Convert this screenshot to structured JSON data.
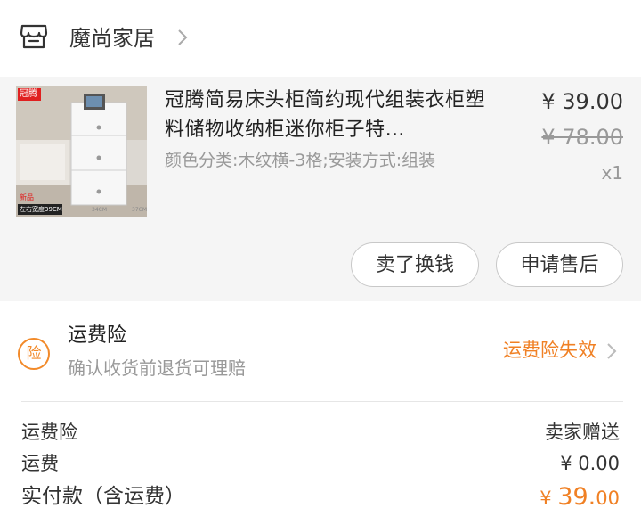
{
  "shop": {
    "name": "魔尚家居",
    "icon": "storefront-icon"
  },
  "product": {
    "thumbnail": {
      "brand_tag": "冠腾",
      "bottom_tag": "左右宽度39CM",
      "sub_tag": "新品"
    },
    "title": "冠腾简易床头柜简约现代组装衣柜塑料储物收纳柜迷你柜子特…",
    "sku": "颜色分类:木纹横-3格;安装方式:组装",
    "price": "¥ 39.00",
    "original_price": "¥ 78.00",
    "quantity": "x1"
  },
  "actions": {
    "resell_label": "卖了换钱",
    "aftersale_label": "申请售后"
  },
  "insurance": {
    "icon_text": "险",
    "title": "运费险",
    "description": "确认收货前退货可理赔",
    "status": "运费险失效"
  },
  "fees": {
    "insurance_label": "运费险",
    "insurance_value": "卖家赠送",
    "shipping_label": "运费",
    "shipping_value": "¥ 0.00",
    "total_label": "实付款（含运费）",
    "total_currency": "¥ ",
    "total_integer": "39.",
    "total_decimal": "00"
  },
  "colors": {
    "accent": "#f08024",
    "background_gray": "#f5f5f5"
  }
}
